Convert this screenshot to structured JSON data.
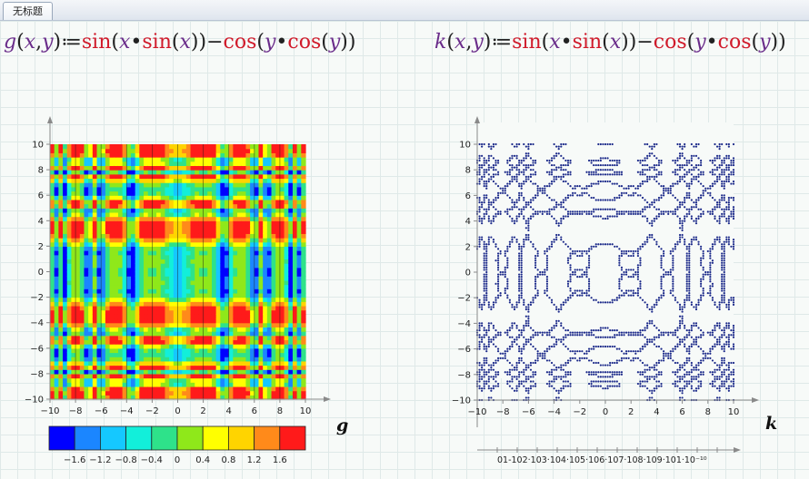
{
  "window": {
    "tab_title": "无标题"
  },
  "formulas": {
    "g": {
      "name": "g",
      "arg1": "x",
      "arg2": "y",
      "assign": "≔",
      "fn1": "sin",
      "fn2": "cos",
      "minus": "−",
      "dot": "•"
    },
    "k": {
      "name": "k",
      "arg1": "x",
      "arg2": "y",
      "assign": "≔",
      "fn1": "sin",
      "fn2": "cos",
      "minus": "−",
      "dot": "•"
    }
  },
  "colorbar": {
    "ticks": [
      "−1.6",
      "−1.2",
      "−0.8",
      "−0.4",
      "0",
      "0.4",
      "0.8",
      "1.2",
      "1.6"
    ],
    "colors": [
      "#0000ff",
      "#1b86ff",
      "#15c8ff",
      "#12efda",
      "#2ee28a",
      "#8fe81a",
      "#ffff00",
      "#ffd400",
      "#ff8a1a",
      "#ff1a1a"
    ]
  },
  "plot_labels": {
    "g": "g",
    "k": "k"
  },
  "k_axis_ticks": "01-102·103·104·105·106·107·108·109·101·10⁻¹⁰",
  "chart_data": [
    {
      "type": "heatmap",
      "title": "",
      "function": "g(x,y) = sin(x·sin(x)) − cos(y·cos(y))",
      "x_ticks": [
        "−10",
        "−8",
        "−6",
        "−4",
        "−2",
        "0",
        "2",
        "4",
        "6",
        "8",
        "10"
      ],
      "y_ticks": [
        "10",
        "8",
        "6",
        "4",
        "2",
        "0",
        "−2",
        "−4",
        "−6",
        "−8",
        "−10"
      ],
      "xlim": [
        -10,
        10
      ],
      "ylim": [
        -10,
        10
      ],
      "zlim": [
        -2,
        2
      ],
      "colorbar_ticks": [
        -1.6,
        -1.2,
        -0.8,
        -0.4,
        0,
        0.4,
        0.8,
        1.2,
        1.6
      ]
    },
    {
      "type": "scatter",
      "title": "",
      "function": "k(x,y) = sin(x·sin(x)) − cos(y·cos(y))",
      "contour_level": 0,
      "x_ticks": [
        "−10",
        "−8",
        "−6",
        "−4",
        "−2",
        "0",
        "2",
        "4",
        "6",
        "8",
        "10"
      ],
      "y_ticks": [
        "10",
        "8",
        "6",
        "4",
        "2",
        "0",
        "−2",
        "−4",
        "−6",
        "−8",
        "−10"
      ],
      "xlim": [
        -10,
        10
      ],
      "ylim": [
        -10,
        10
      ],
      "color": "#1c2a8a"
    }
  ]
}
